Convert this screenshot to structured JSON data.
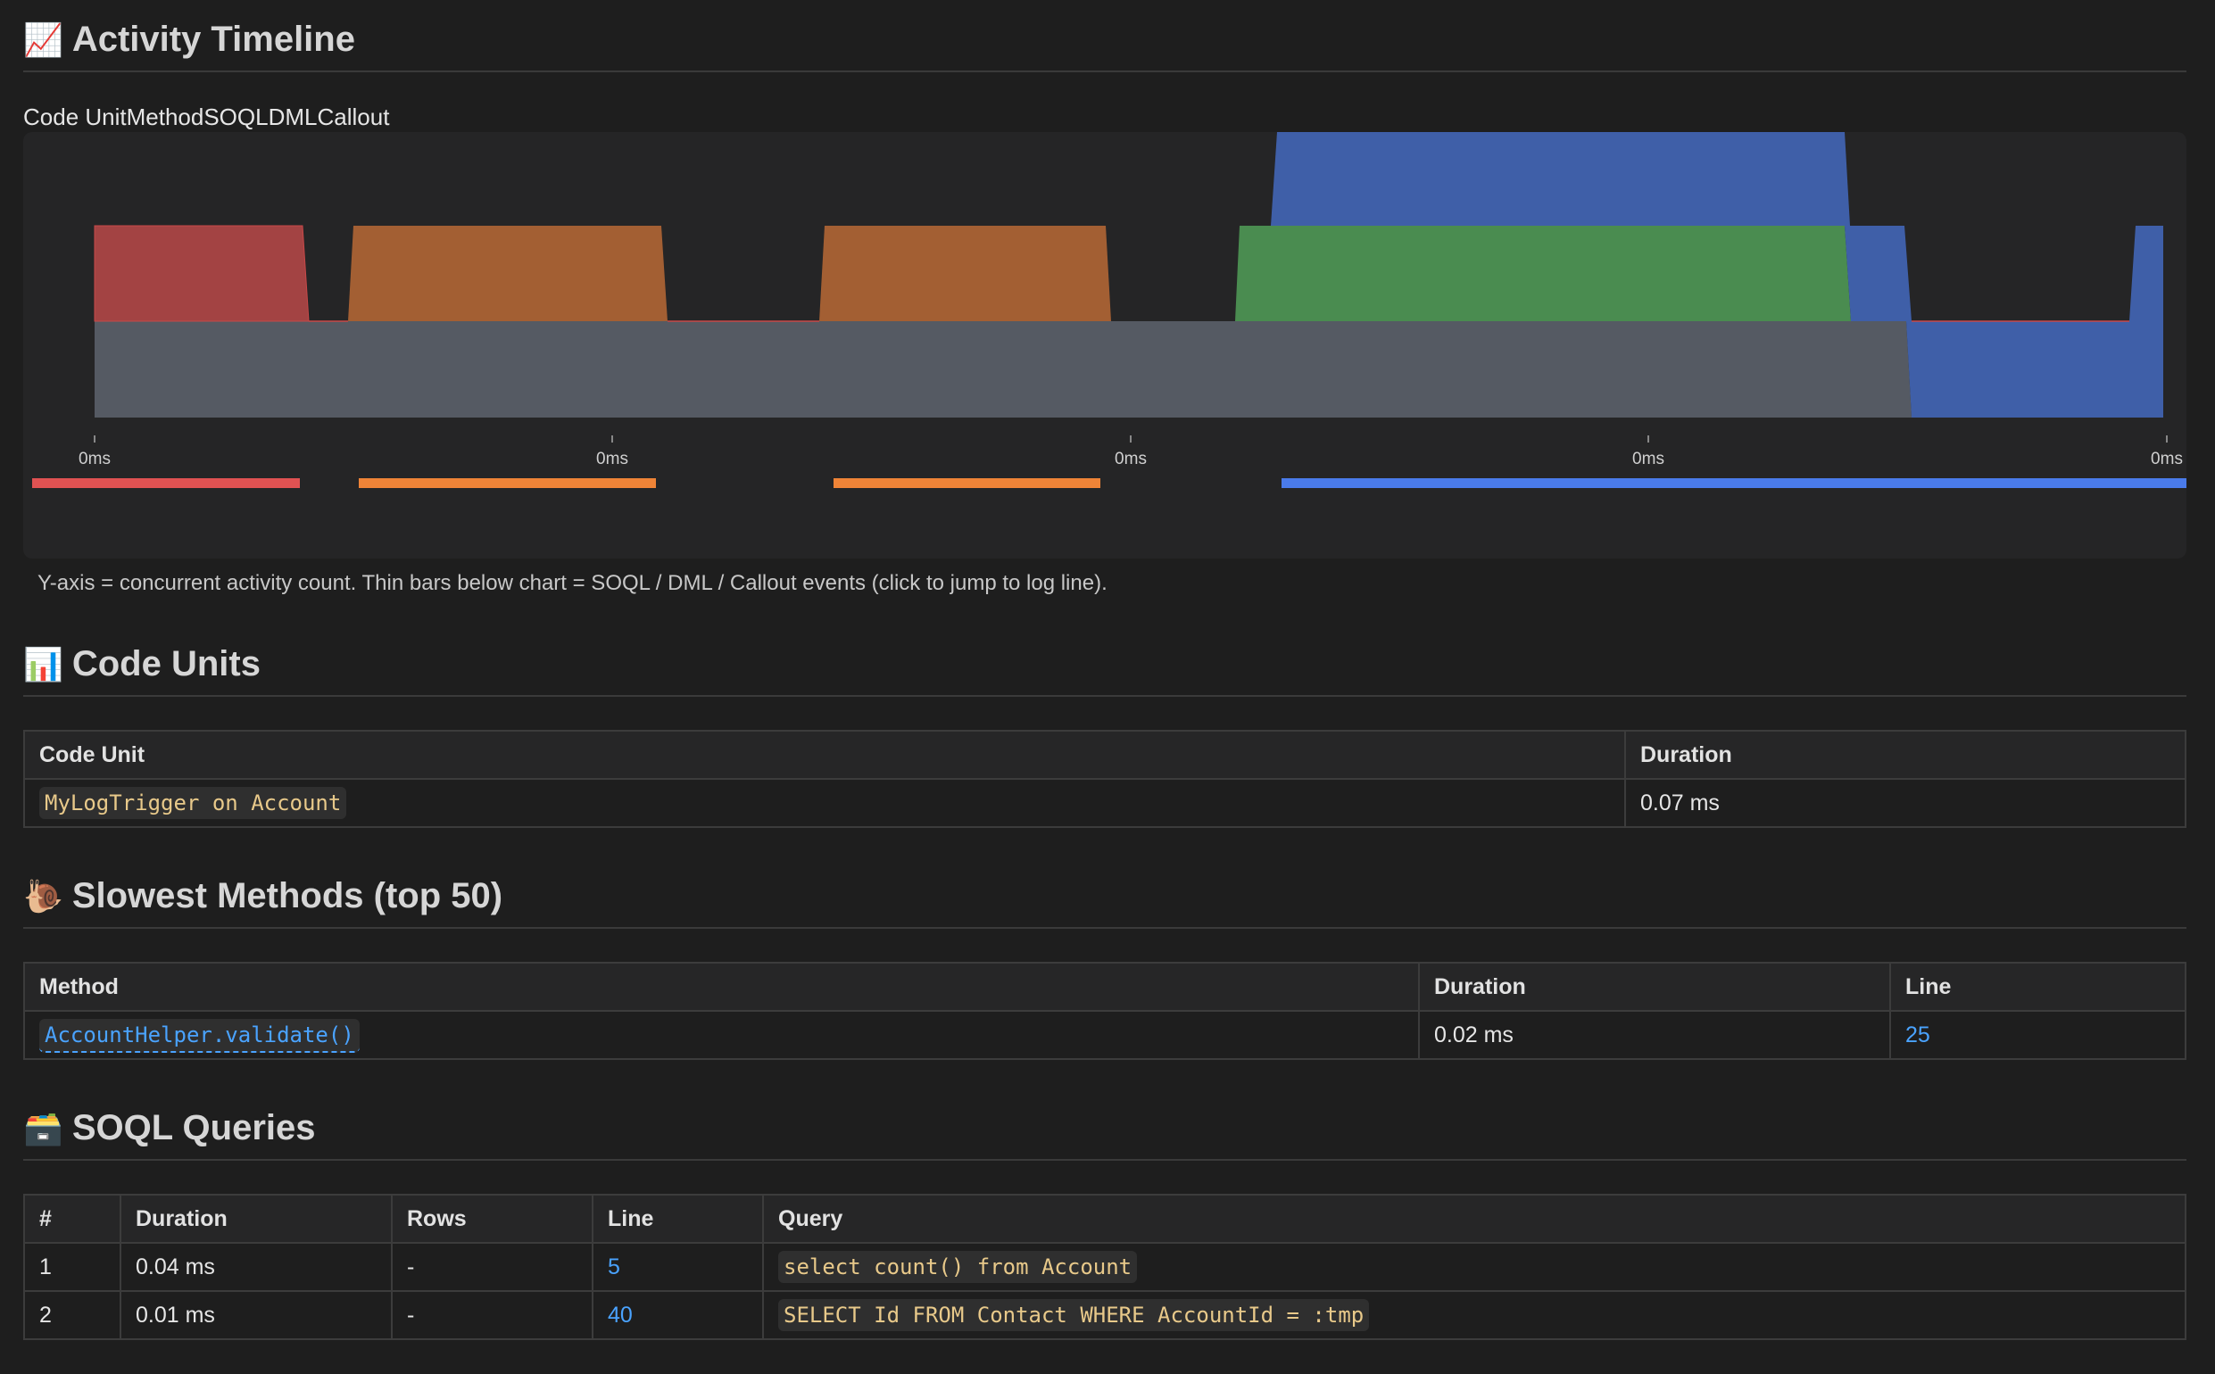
{
  "timeline": {
    "title": "Activity Timeline",
    "icon": "chart-increasing-icon",
    "legend_text": "Code UnitMethodSOQLDMLCallout",
    "note": "Y-axis = concurrent activity count. Thin bars below chart = SOQL / DML / Callout events (click to jump to log line).",
    "colors": {
      "code_unit": "#555a63",
      "method_red": "#a34343",
      "method_orange": "#a35f33",
      "soql_green": "#4a8c50",
      "callout_blue": "#3f5fa8",
      "bar_red": "#e05252",
      "bar_orange": "#ef8437",
      "bar_blue": "#4a7bea"
    }
  },
  "chart_data": {
    "type": "area",
    "y_meaning": "concurrent activity count",
    "x_tick_labels": [
      "0ms",
      "0ms",
      "0ms",
      "0ms",
      "0ms"
    ],
    "event_bars": [
      "SOQL",
      "SOQL",
      "SOQL",
      "Callout"
    ]
  },
  "code_units": {
    "title": "Code Units",
    "icon": "bar-chart-icon",
    "headers": [
      "Code Unit",
      "Duration"
    ],
    "rows": [
      {
        "unit": "MyLogTrigger on Account",
        "duration": "0.07 ms"
      }
    ]
  },
  "slowest": {
    "title": "Slowest Methods (top 50)",
    "icon": "snail-icon",
    "headers": [
      "Method",
      "Duration",
      "Line"
    ],
    "rows": [
      {
        "method": "AccountHelper.validate()",
        "duration": "0.02 ms",
        "line": "25"
      }
    ]
  },
  "soql": {
    "title": "SOQL Queries",
    "icon": "card-file-box-icon",
    "headers": [
      "#",
      "Duration",
      "Rows",
      "Line",
      "Query"
    ],
    "rows": [
      {
        "n": "1",
        "duration": "0.04 ms",
        "rows": "-",
        "line": "5",
        "query": "select count() from Account"
      },
      {
        "n": "2",
        "duration": "0.01 ms",
        "rows": "-",
        "line": "40",
        "query": "SELECT Id FROM Contact WHERE AccountId = :tmp"
      }
    ]
  }
}
